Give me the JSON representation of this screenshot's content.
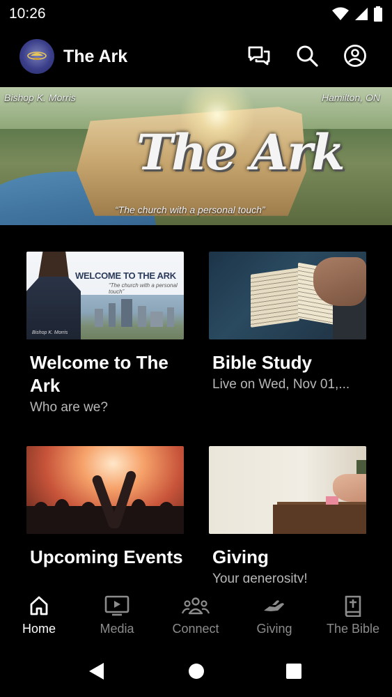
{
  "status_bar": {
    "time": "10:26"
  },
  "app_bar": {
    "title": "The Ark",
    "icons": [
      "chat-icon",
      "search-icon",
      "account-icon"
    ]
  },
  "hero": {
    "top_left": "Bishop K. Morris",
    "top_right": "Hamilton, ON",
    "wordmark": "The Ark",
    "tagline": "“The church with a personal touch”"
  },
  "cards": [
    {
      "title": "Welcome to The Ark",
      "subtitle": "Who are we?",
      "thumb_text": "WELCOME TO THE ARK",
      "thumb_tagline": "“The church with a personal touch”",
      "thumb_caption": "Bishop K. Morris"
    },
    {
      "title": "Bible Study",
      "subtitle": "Live on Wed, Nov 01,..."
    },
    {
      "title": "Upcoming Events",
      "subtitle": ""
    },
    {
      "title": "Giving",
      "subtitle": "Your generosity!"
    }
  ],
  "bottom_nav": [
    {
      "label": "Home",
      "icon": "home-icon",
      "active": true
    },
    {
      "label": "Media",
      "icon": "media-icon",
      "active": false
    },
    {
      "label": "Connect",
      "icon": "connect-icon",
      "active": false
    },
    {
      "label": "Giving",
      "icon": "giving-icon",
      "active": false
    },
    {
      "label": "The Bible",
      "icon": "bible-icon",
      "active": false
    }
  ],
  "system_nav": [
    "back-icon",
    "home-circle-icon",
    "recents-icon"
  ]
}
